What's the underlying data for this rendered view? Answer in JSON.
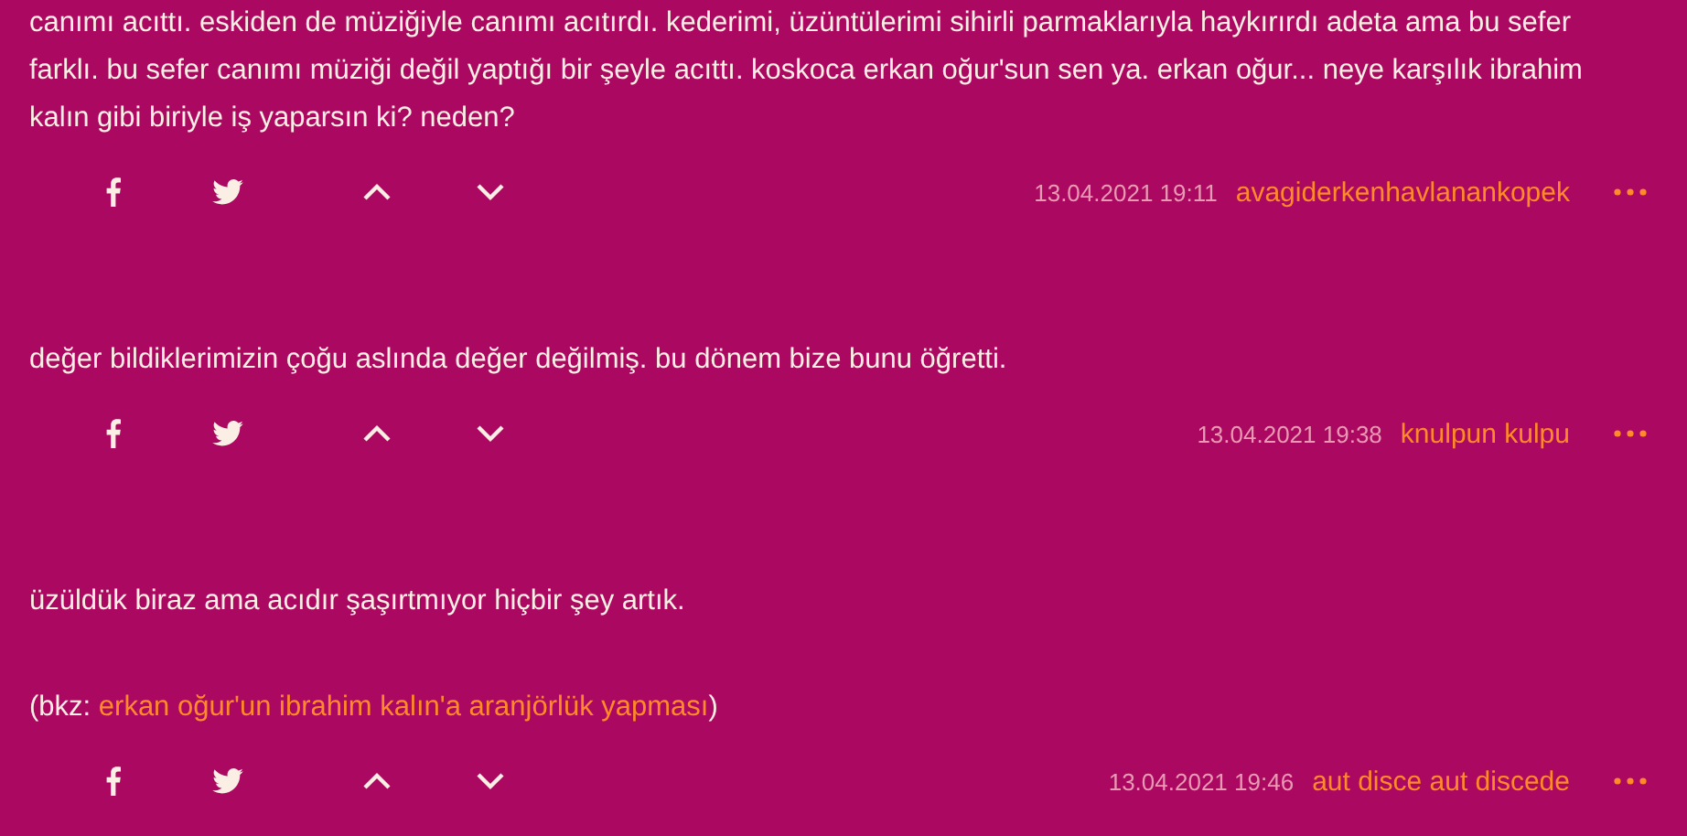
{
  "entries": [
    {
      "paragraphs": [
        {
          "kind": "text",
          "text": "canımı acıttı. eskiden de müziğiyle canımı acıtırdı. kederimi, üzüntülerimi sihirli parmaklarıyla haykırırdı adeta ama bu sefer farklı. bu sefer canımı müziği değil yaptığı bir şeyle acıttı. koskoca erkan oğur'sun sen ya. erkan oğur... neye karşılık ibrahim kalın gibi biriyle iş yaparsın ki? neden?"
        }
      ],
      "date": "13.04.2021 19:11",
      "author": "avagiderkenhavlanankopek"
    },
    {
      "paragraphs": [
        {
          "kind": "text",
          "text": "değer bildiklerimizin çoğu aslında değer değilmiş. bu dönem bize bunu öğretti."
        }
      ],
      "date": "13.04.2021 19:38",
      "author": "knulpun kulpu"
    },
    {
      "paragraphs": [
        {
          "kind": "text",
          "text": "üzüldük biraz ama acıdır şaşırtmıyor hiçbir şey artık."
        },
        {
          "kind": "bkz",
          "prefix": "(bkz:",
          "link": "erkan oğur'un ibrahim kalın'a aranjörlük yapması",
          "suffix": ")"
        }
      ],
      "date": "13.04.2021 19:46",
      "author": "aut disce aut discede"
    }
  ]
}
